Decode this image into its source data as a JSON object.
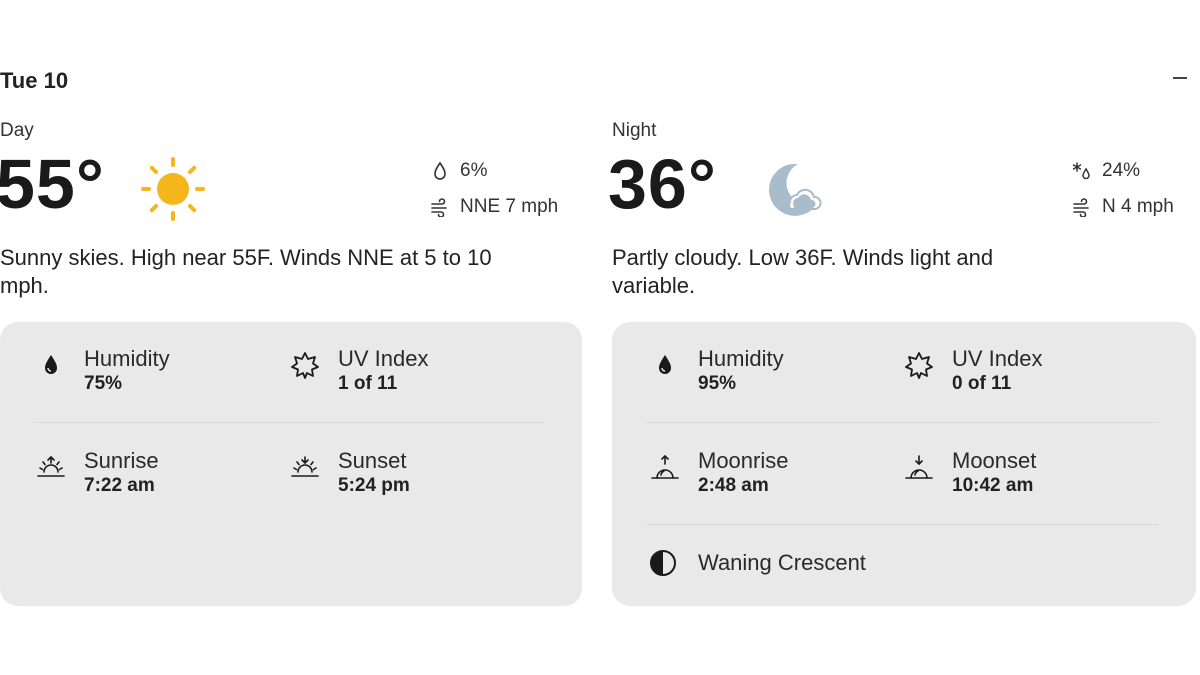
{
  "header": {
    "date": "Tue 10"
  },
  "colors": {
    "sun": "#f5b61c",
    "moon": "#a9bccb",
    "card_bg": "#e9e9e9"
  },
  "day": {
    "label": "Day",
    "temp": "55°",
    "icon": "sun-icon",
    "precip": "6%",
    "wind": "NNE 7 mph",
    "description": "Sunny skies. High near 55F. Winds NNE at 5 to 10 mph.",
    "details": {
      "humidity_label": "Humidity",
      "humidity_value": "75%",
      "uv_label": "UV Index",
      "uv_value": "1 of 11",
      "rise_label": "Sunrise",
      "rise_value": "7:22 am",
      "set_label": "Sunset",
      "set_value": "5:24 pm"
    }
  },
  "night": {
    "label": "Night",
    "temp": "36°",
    "icon": "moon-cloud-icon",
    "precip": "24%",
    "wind": "N 4 mph",
    "description": "Partly cloudy. Low 36F. Winds light and variable.",
    "details": {
      "humidity_label": "Humidity",
      "humidity_value": "95%",
      "uv_label": "UV Index",
      "uv_value": "0 of 11",
      "rise_label": "Moonrise",
      "rise_value": "2:48 am",
      "set_label": "Moonset",
      "set_value": "10:42 am",
      "phase": "Waning Crescent"
    }
  }
}
